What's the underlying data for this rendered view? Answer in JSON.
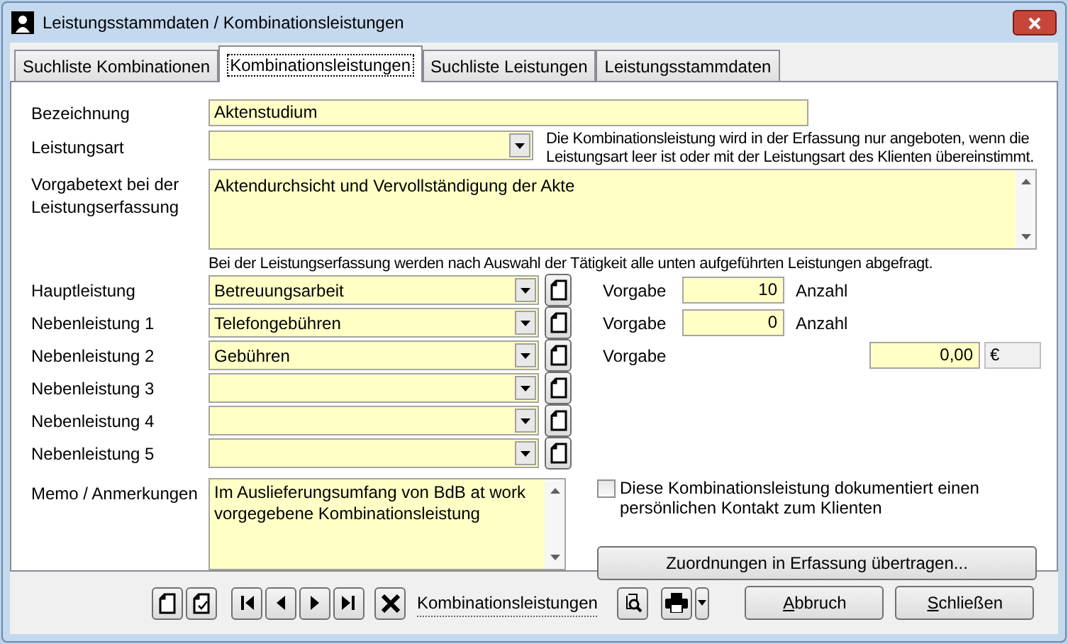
{
  "window": {
    "title": "Leistungsstammdaten / Kombinationsleistungen"
  },
  "tabs": [
    {
      "label": "Suchliste Kombinationen",
      "selected": false
    },
    {
      "label": "Kombinationsleistungen",
      "selected": true
    },
    {
      "label": "Suchliste Leistungen",
      "selected": false
    },
    {
      "label": "Leistungsstammdaten",
      "selected": false
    }
  ],
  "bezeichnung": {
    "label": "Bezeichnung",
    "value": "Aktenstudium"
  },
  "leistungsart": {
    "label": "Leistungsart",
    "hint": "Die Kombinationsleistung wird in der Erfassung nur angeboten, wenn die Leistungsart leer ist oder mit der Leistungsart des Klienten übereinstimmt."
  },
  "vorgabetext": {
    "label": "Vorgabetext bei der Leistungserfassung",
    "value": "Aktendurchsicht und Vervollständigung der Akte"
  },
  "leistungen_hint": "Bei der Leistungserfassung werden nach Auswahl der Tätigkeit alle unten aufgeführten Leistungen abgefragt.",
  "leistungen": [
    {
      "label": "Hauptleistung",
      "value": "Betreuungsarbeit",
      "vorgabe": {
        "kind": "count",
        "label": "Vorgabe",
        "value": "10",
        "unit": "Anzahl"
      }
    },
    {
      "label": "Nebenleistung 1",
      "value": "Telefongebühren",
      "vorgabe": {
        "kind": "count",
        "label": "Vorgabe",
        "value": "0",
        "unit": "Anzahl"
      }
    },
    {
      "label": "Nebenleistung 2",
      "value": "Gebühren",
      "vorgabe": {
        "kind": "amount",
        "label": "Vorgabe",
        "value": "0,00",
        "unit": "€"
      }
    },
    {
      "label": "Nebenleistung 3"
    },
    {
      "label": "Nebenleistung 4"
    },
    {
      "label": "Nebenleistung 5"
    }
  ],
  "memo": {
    "label": "Memo / Anmerkungen",
    "value": "Im Auslieferungsumfang von BdB at work vorgegebene Kombinationsleistung"
  },
  "kontakt": {
    "label": "Diese Kombinationsleistung dokumentiert einen persönlichen Kontakt zum Klienten",
    "checked": false
  },
  "transfer_button": "Zuordnungen in Erfassung übertragen...",
  "toolbar": {
    "record_label": "Kombinationsleistungen"
  },
  "buttons": [
    "Abbruch",
    "Schließen"
  ]
}
